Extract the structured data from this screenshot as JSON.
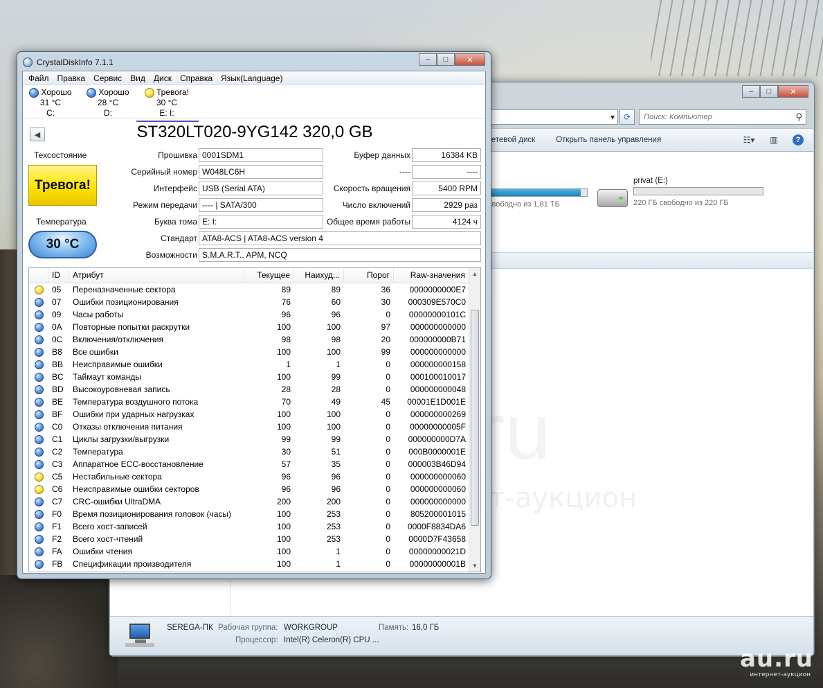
{
  "explorer": {
    "search_placeholder": "Поиск: Компьютер",
    "toolbar": {
      "network_drive": "сетевой диск",
      "control_panel": "Открыть панель управления"
    },
    "drives": [
      {
        "name": "",
        "free_text": "свободно из 1,81 ТБ",
        "used_fraction": 0.94
      },
      {
        "name": "privat (E:)",
        "free_text": "220 ГБ свободно из 220 ГБ",
        "used_fraction": 0.0
      }
    ],
    "status": {
      "pc_name": "SEREGA-ПК",
      "workgroup_label": "Рабочая группа:",
      "workgroup_value": "WORKGROUP",
      "memory_label": "Память:",
      "memory_value": "16,0 ГБ",
      "cpu_label": "Процессор:",
      "cpu_value": "Intel(R) Celeron(R) CPU ..."
    }
  },
  "cdi": {
    "title": "CrystalDiskInfo 7.1.1",
    "menu": [
      "Файл",
      "Правка",
      "Сервис",
      "Вид",
      "Диск",
      "Справка",
      "Язык(Language)"
    ],
    "disks": [
      {
        "status": "Хорошо",
        "temp": "31 °C",
        "letter": "C:",
        "color": "blue"
      },
      {
        "status": "Хорошо",
        "temp": "28 °C",
        "letter": "D:",
        "color": "blue"
      },
      {
        "status": "Тревога!",
        "temp": "30 °C",
        "letter": "E: I:",
        "color": "yellow"
      }
    ],
    "model": "ST320LT020-9YG142 320,0 GB",
    "health_label": "Техсостояние",
    "health_value": "Тревога!",
    "temp_label": "Температура",
    "temp_value": "30 °C",
    "fields": {
      "firmware_label": "Прошивка",
      "firmware": "0001SDM1",
      "serial_label": "Серийный номер",
      "serial": "W048LC6H",
      "interface_label": "Интерфейс",
      "interface": "USB (Serial ATA)",
      "transfer_label": "Режим передачи",
      "transfer": "---- | SATA/300",
      "letter_label": "Буква тома",
      "letter": "E: I:",
      "standard_label": "Стандарт",
      "standard": "ATA8-ACS | ATA8-ACS version 4",
      "features_label": "Возможности",
      "features": "S.M.A.R.T., APM, NCQ",
      "buffer_label": "Буфер данных",
      "buffer": "16384 KB",
      "nv_label": "----",
      "nv": "----",
      "rpm_label": "Скорость вращения",
      "rpm": "5400 RPM",
      "power_count_label": "Число включений",
      "power_count": "2929 раз",
      "power_hours_label": "Общее время работы",
      "power_hours": "4124 ч"
    },
    "table": {
      "headers": [
        "ID",
        "Атрибут",
        "Текущее",
        "Наихуд...",
        "Порог",
        "Raw-значения"
      ],
      "rows": [
        {
          "s": "yellow",
          "id": "05",
          "attr": "Переназначенные сектора",
          "cur": "89",
          "worst": "89",
          "thr": "36",
          "raw": "0000000000E7"
        },
        {
          "s": "blue",
          "id": "07",
          "attr": "Ошибки позиционирования",
          "cur": "76",
          "worst": "60",
          "thr": "30",
          "raw": "000309E570C0"
        },
        {
          "s": "blue",
          "id": "09",
          "attr": "Часы работы",
          "cur": "96",
          "worst": "96",
          "thr": "0",
          "raw": "00000000101C"
        },
        {
          "s": "blue",
          "id": "0A",
          "attr": "Повторные попытки раскрутки",
          "cur": "100",
          "worst": "100",
          "thr": "97",
          "raw": "000000000000"
        },
        {
          "s": "blue",
          "id": "0C",
          "attr": "Включения/отключения",
          "cur": "98",
          "worst": "98",
          "thr": "20",
          "raw": "000000000B71"
        },
        {
          "s": "blue",
          "id": "B8",
          "attr": "Все ошибки",
          "cur": "100",
          "worst": "100",
          "thr": "99",
          "raw": "000000000000"
        },
        {
          "s": "blue",
          "id": "BB",
          "attr": "Неисправимые ошибки",
          "cur": "1",
          "worst": "1",
          "thr": "0",
          "raw": "000000000158"
        },
        {
          "s": "blue",
          "id": "BC",
          "attr": "Таймаут команды",
          "cur": "100",
          "worst": "99",
          "thr": "0",
          "raw": "000100010017"
        },
        {
          "s": "blue",
          "id": "BD",
          "attr": "Высокоуровневая запись",
          "cur": "28",
          "worst": "28",
          "thr": "0",
          "raw": "000000000048"
        },
        {
          "s": "blue",
          "id": "BE",
          "attr": "Температура воздушного потока",
          "cur": "70",
          "worst": "49",
          "thr": "45",
          "raw": "00001E1D001E"
        },
        {
          "s": "blue",
          "id": "BF",
          "attr": "Ошибки при ударных нагрузках",
          "cur": "100",
          "worst": "100",
          "thr": "0",
          "raw": "000000000269"
        },
        {
          "s": "blue",
          "id": "C0",
          "attr": "Отказы отключения питания",
          "cur": "100",
          "worst": "100",
          "thr": "0",
          "raw": "00000000005F"
        },
        {
          "s": "blue",
          "id": "C1",
          "attr": "Циклы загрузки/выгрузки",
          "cur": "99",
          "worst": "99",
          "thr": "0",
          "raw": "000000000D7A"
        },
        {
          "s": "blue",
          "id": "C2",
          "attr": "Температура",
          "cur": "30",
          "worst": "51",
          "thr": "0",
          "raw": "000B0000001E"
        },
        {
          "s": "blue",
          "id": "C3",
          "attr": "Аппаратное ECC-восстановление",
          "cur": "57",
          "worst": "35",
          "thr": "0",
          "raw": "000003B46D94"
        },
        {
          "s": "yellow",
          "id": "C5",
          "attr": "Нестабильные сектора",
          "cur": "96",
          "worst": "96",
          "thr": "0",
          "raw": "000000000060"
        },
        {
          "s": "yellow",
          "id": "C6",
          "attr": "Неисправимые ошибки секторов",
          "cur": "96",
          "worst": "96",
          "thr": "0",
          "raw": "000000000060"
        },
        {
          "s": "blue",
          "id": "C7",
          "attr": "CRC-ошибки UltraDMA",
          "cur": "200",
          "worst": "200",
          "thr": "0",
          "raw": "000000000000"
        },
        {
          "s": "blue",
          "id": "F0",
          "attr": "Время позиционирования головок (часы)",
          "cur": "100",
          "worst": "253",
          "thr": "0",
          "raw": "805200001015"
        },
        {
          "s": "blue",
          "id": "F1",
          "attr": "Всего хост-записей",
          "cur": "100",
          "worst": "253",
          "thr": "0",
          "raw": "0000F8834DA6"
        },
        {
          "s": "blue",
          "id": "F2",
          "attr": "Всего хост-чтений",
          "cur": "100",
          "worst": "253",
          "thr": "0",
          "raw": "0000D7F43658"
        },
        {
          "s": "blue",
          "id": "FA",
          "attr": "Ошибки чтения",
          "cur": "100",
          "worst": "1",
          "thr": "0",
          "raw": "00000000021D"
        },
        {
          "s": "blue",
          "id": "FB",
          "attr": "Спецификации производителя",
          "cur": "100",
          "worst": "1",
          "thr": "0",
          "raw": "00000000001B"
        }
      ]
    }
  },
  "watermark": {
    "big": "au.ru",
    "small": "интернет-аукцион",
    "center": "au.ru",
    "center2": "интернет-аукцион"
  },
  "colors": {
    "alarm": "#ffe400",
    "good": "#3d83d0",
    "title_bar": "#c8d7e4"
  }
}
